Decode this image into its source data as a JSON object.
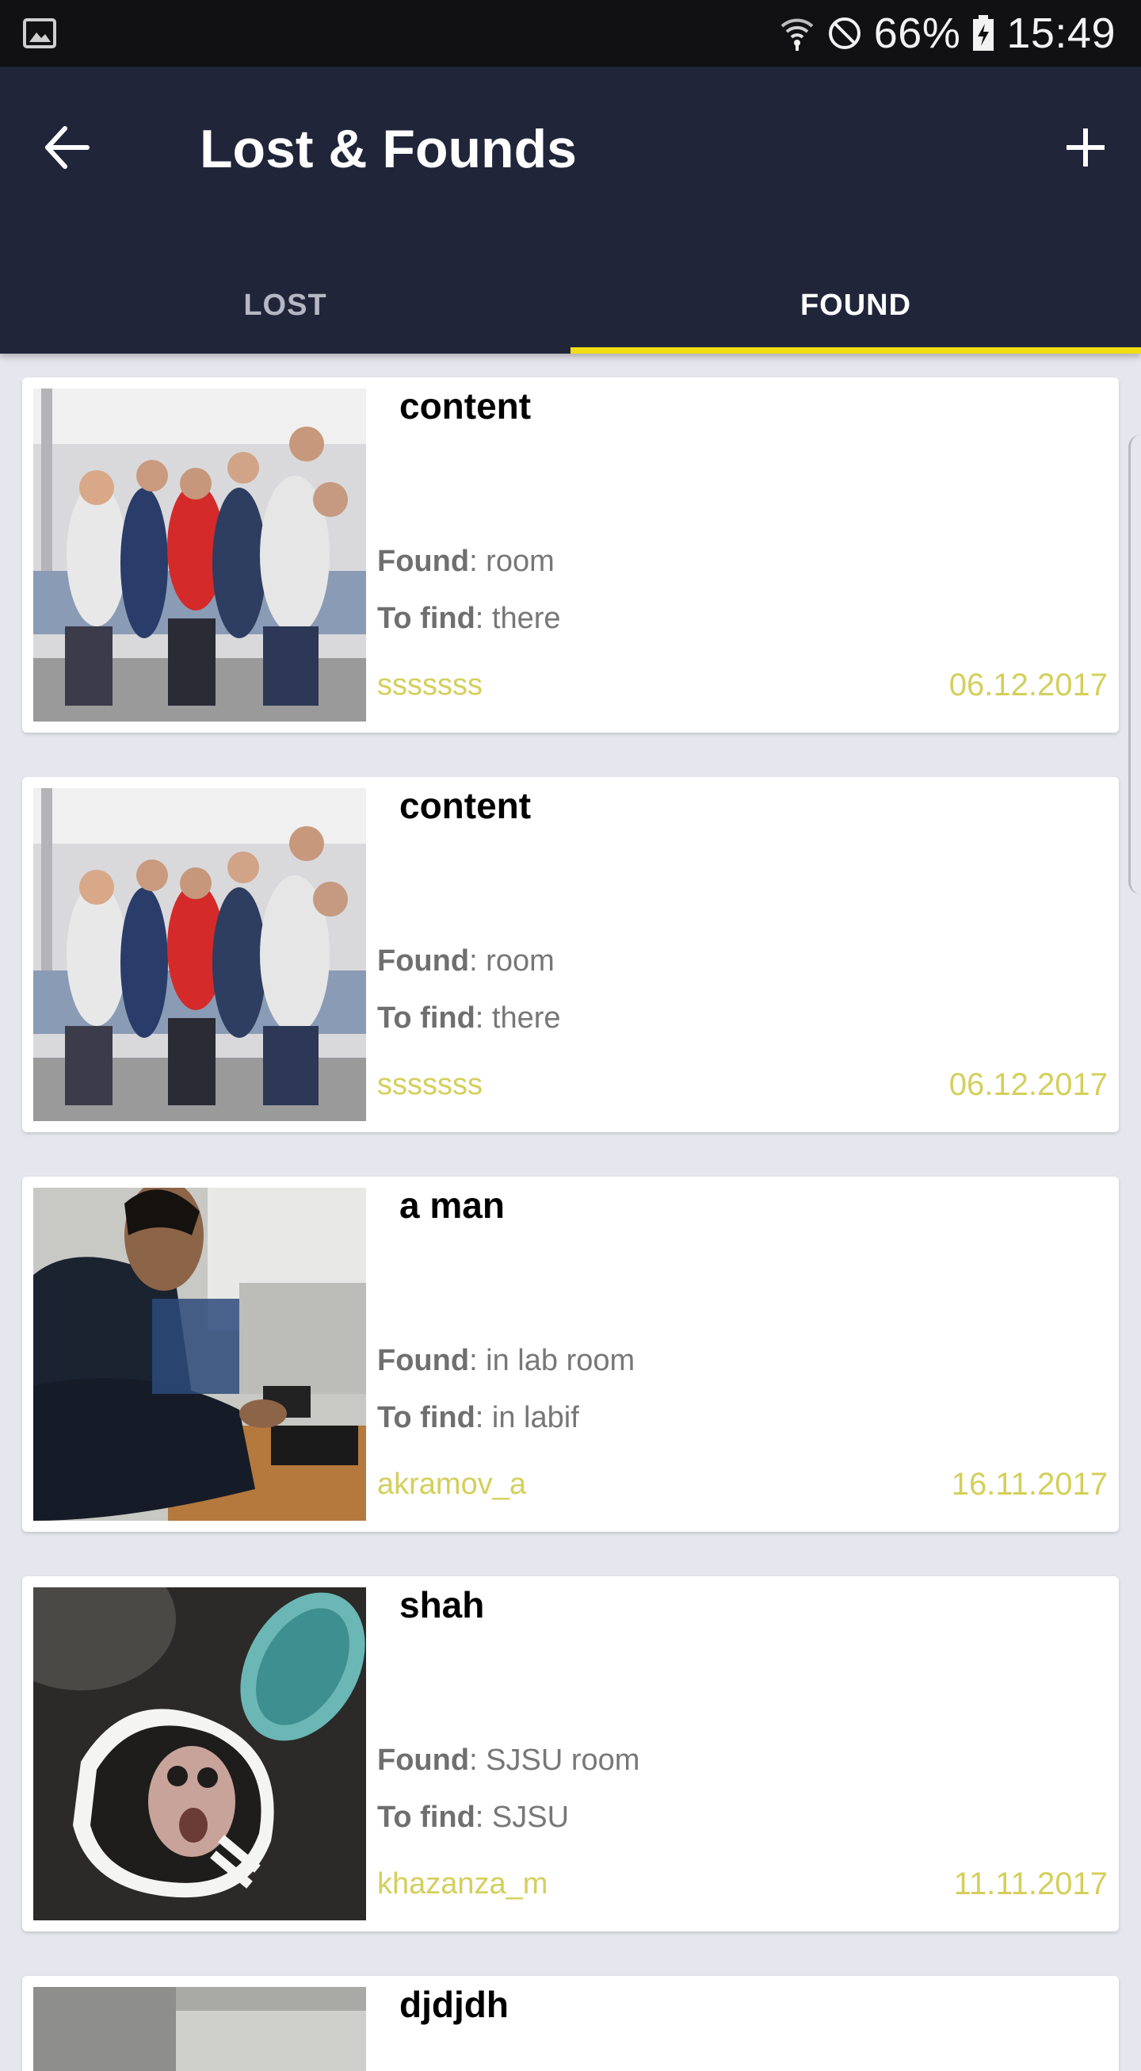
{
  "status_bar": {
    "battery": "66%",
    "time": "15:49"
  },
  "app_bar": {
    "title": "Lost & Founds"
  },
  "tabs": [
    {
      "label": "LOST",
      "selected": false
    },
    {
      "label": "FOUND",
      "selected": true
    }
  ],
  "colors": {
    "appbar": "#20253a",
    "tab_indicator": "#f2dc14",
    "accent_text": "#d4cf5b",
    "background": "#e6e6ee"
  },
  "items": [
    {
      "title": "content",
      "found_label": "Found",
      "found_value": ": room",
      "find_label": "To find",
      "find_value": ": there",
      "user": "sssssss",
      "date": "06.12.2017"
    },
    {
      "title": "content",
      "found_label": "Found",
      "found_value": ": room",
      "find_label": "To find",
      "find_value": ": there",
      "user": "sssssss",
      "date": "06.12.2017"
    },
    {
      "title": "a man",
      "found_label": "Found",
      "found_value": ": in lab room",
      "find_label": "To find",
      "find_value": ": in labif",
      "user": "akramov_a",
      "date": "16.11.2017"
    },
    {
      "title": "shah",
      "found_label": "Found",
      "found_value": ": SJSU room",
      "find_label": "To find",
      "find_value": ": SJSU",
      "user": "khazanza_m",
      "date": "11.11.2017"
    },
    {
      "title": "djdjdh"
    }
  ]
}
